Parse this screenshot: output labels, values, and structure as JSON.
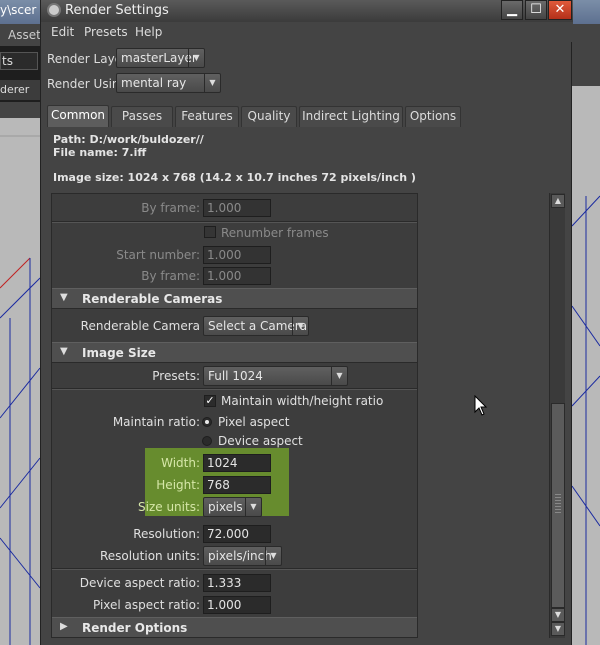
{
  "background": {
    "title_fragment": "y\\scer",
    "menu_item": "Assets",
    "field_text": "ts",
    "panel_title": "derer"
  },
  "window": {
    "title": "Render Settings",
    "controls": {
      "minimize": "▁",
      "maximize": "☐",
      "close": "✕"
    }
  },
  "menu": [
    "Edit",
    "Presets",
    "Help"
  ],
  "render_layer": {
    "label": "Render Layer",
    "value": "masterLayer"
  },
  "render_using": {
    "label": "Render Using",
    "value": "mental ray"
  },
  "tabs": [
    {
      "label": "Common",
      "active": true
    },
    {
      "label": "Passes",
      "active": false
    },
    {
      "label": "Features",
      "active": false
    },
    {
      "label": "Quality",
      "active": false
    },
    {
      "label": "Indirect Lighting",
      "active": false
    },
    {
      "label": "Options",
      "active": false
    }
  ],
  "info": {
    "path": "Path: D:/work/buldozer//",
    "file_name": "File name:  7.iff",
    "image_size": "Image size: 1024 x 768 (14.2 x 10.7 inches 72 pixels/inch )"
  },
  "frames": {
    "by_frame_1": {
      "label": "By frame:",
      "value": "1.000"
    },
    "renumber": {
      "label": "Renumber frames",
      "checked": false
    },
    "start_number": {
      "label": "Start number:",
      "value": "1.000"
    },
    "by_frame_2": {
      "label": "By frame:",
      "value": "1.000"
    }
  },
  "renderable_cameras": {
    "header": "Renderable Cameras",
    "label": "Renderable Camera",
    "value": "Select a Camera"
  },
  "image_size": {
    "header": "Image Size",
    "presets": {
      "label": "Presets:",
      "value": "Full 1024"
    },
    "maintain_ratio_check": {
      "label": "Maintain width/height ratio",
      "checked": true
    },
    "maintain_ratio": {
      "label": "Maintain ratio:",
      "option_pixel": "Pixel aspect",
      "option_device": "Device aspect",
      "selected": "Pixel aspect"
    },
    "width": {
      "label": "Width:",
      "value": "1024"
    },
    "height": {
      "label": "Height:",
      "value": "768"
    },
    "size_units": {
      "label": "Size units:",
      "value": "pixels"
    },
    "resolution": {
      "label": "Resolution:",
      "value": "72.000"
    },
    "resolution_units": {
      "label": "Resolution units:",
      "value": "pixels/inch"
    },
    "device_aspect": {
      "label": "Device aspect ratio:",
      "value": "1.333"
    },
    "pixel_aspect": {
      "label": "Pixel aspect ratio:",
      "value": "1.000"
    }
  },
  "render_options": {
    "header": "Render Options"
  },
  "colors": {
    "highlight": "#6f9a2c",
    "close_button": "#c8401f",
    "panel_bg": "#3d3d3d"
  }
}
